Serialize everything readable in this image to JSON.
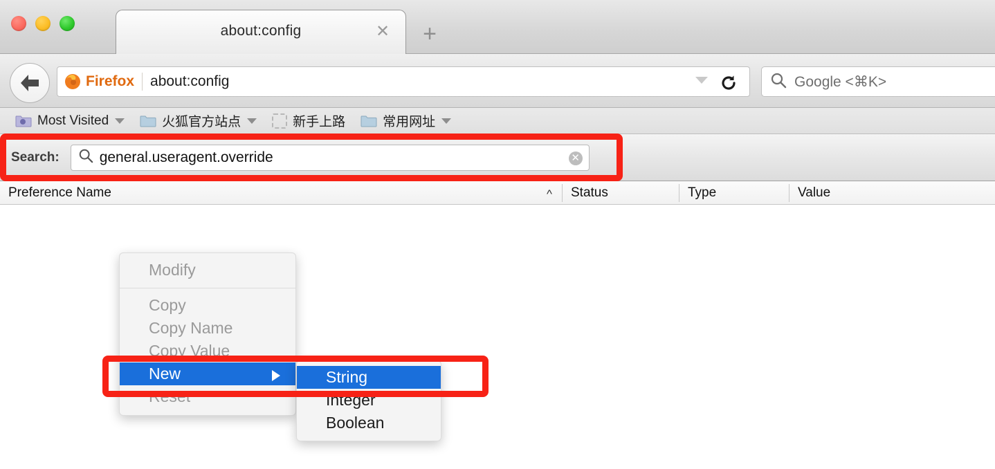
{
  "window": {
    "traffic_lights": [
      "close",
      "minimize",
      "zoom"
    ]
  },
  "tabbar": {
    "tab_title": "about:config",
    "close_glyph": "✕",
    "newtab_glyph": "+"
  },
  "navbar": {
    "back_icon": "back-arrow-icon",
    "brand_label": "Firefox",
    "url": "about:config",
    "dropdown_icon": "chevron-down-icon",
    "reload_icon": "reload-icon",
    "search_placeholder": "Google <⌘K>",
    "search_icon": "search-icon"
  },
  "bookmarks": [
    {
      "label": "Most Visited",
      "icon": "folder-star-icon",
      "has_caret": true
    },
    {
      "label": "火狐官方站点",
      "icon": "folder-icon",
      "has_caret": true
    },
    {
      "label": "新手上路",
      "icon": "folder-dashed-icon",
      "has_caret": false
    },
    {
      "label": "常用网址",
      "icon": "folder-icon",
      "has_caret": true
    }
  ],
  "config_search": {
    "label": "Search:",
    "value": "general.useragent.override",
    "placeholder": "Search:",
    "search_icon": "search-icon",
    "clear_glyph": "✕"
  },
  "table": {
    "columns": [
      {
        "name": "Preference Name",
        "sort_glyph": "^"
      },
      {
        "name": "Status"
      },
      {
        "name": "Type"
      },
      {
        "name": "Value"
      }
    ],
    "rows": []
  },
  "context_menu": {
    "items": [
      {
        "label": "Modify",
        "state": "disabled",
        "separator_after": true
      },
      {
        "label": "Copy",
        "state": "disabled"
      },
      {
        "label": "Copy Name",
        "state": "disabled"
      },
      {
        "label": "Copy Value",
        "state": "disabled"
      },
      {
        "label": "New",
        "state": "selected",
        "has_submenu": true
      },
      {
        "label": "Reset",
        "state": "disabled"
      }
    ]
  },
  "submenu": {
    "items": [
      {
        "label": "String",
        "state": "selected"
      },
      {
        "label": "Integer",
        "state": "normal"
      },
      {
        "label": "Boolean",
        "state": "normal"
      }
    ]
  },
  "annotations": {
    "highlight_color": "#f72216",
    "rects": [
      {
        "name": "search-field-highlight"
      },
      {
        "name": "new-menu-item-highlight"
      }
    ]
  },
  "colors": {
    "selection_blue": "#1a6fdb",
    "brand_orange": "#e06a10",
    "highlight_red": "#f72216"
  }
}
